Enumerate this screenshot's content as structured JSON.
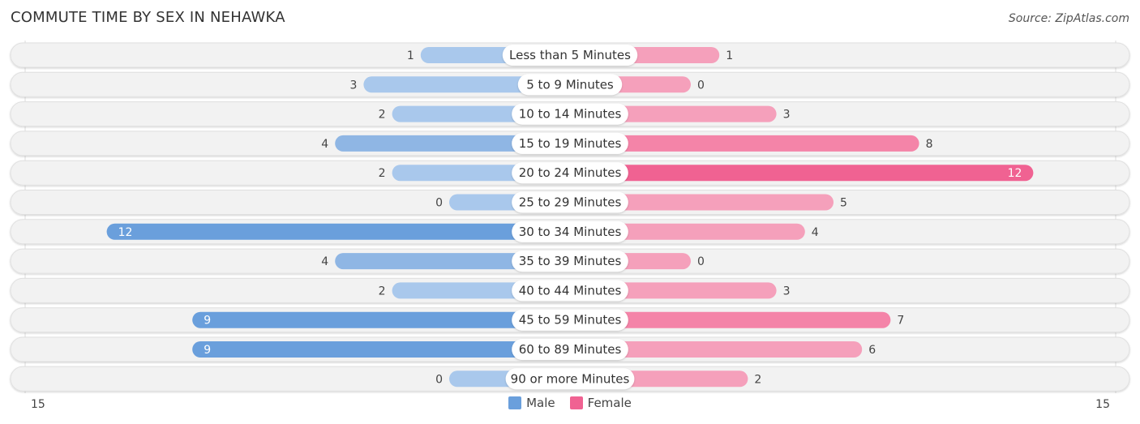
{
  "title": "COMMUTE TIME BY SEX IN NEHAWKA",
  "source": "Source: ZipAtlas.com",
  "colors": {
    "male": "#6a9fdc",
    "male_light": "#a9c8ec",
    "female": "#f06292",
    "female_light": "#f5a0bb",
    "track": "#f2f2f2"
  },
  "chart_data": {
    "type": "bar",
    "orientation": "horizontal-diverging",
    "title": "COMMUTE TIME BY SEX IN NEHAWKA",
    "categories": [
      "Less than 5 Minutes",
      "5 to 9 Minutes",
      "10 to 14 Minutes",
      "15 to 19 Minutes",
      "20 to 24 Minutes",
      "25 to 29 Minutes",
      "30 to 34 Minutes",
      "35 to 39 Minutes",
      "40 to 44 Minutes",
      "45 to 59 Minutes",
      "60 to 89 Minutes",
      "90 or more Minutes"
    ],
    "series": [
      {
        "name": "Male",
        "values": [
          1,
          3,
          2,
          4,
          2,
          0,
          12,
          4,
          2,
          9,
          9,
          0
        ]
      },
      {
        "name": "Female",
        "values": [
          1,
          0,
          3,
          8,
          12,
          5,
          4,
          0,
          3,
          7,
          6,
          2
        ]
      }
    ],
    "axis": {
      "left_tick": "15",
      "right_tick": "15",
      "max": 15
    },
    "legend": {
      "position": "bottom-center",
      "items": [
        "Male",
        "Female"
      ]
    }
  }
}
